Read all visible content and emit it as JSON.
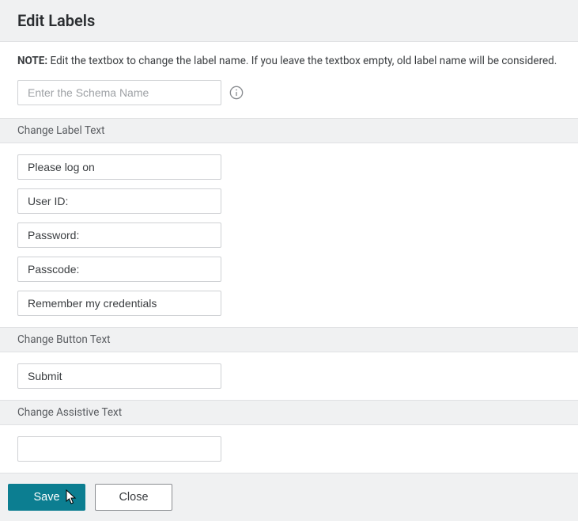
{
  "header": {
    "title": "Edit Labels"
  },
  "note": {
    "prefix": "NOTE:",
    "text": "Edit the textbox to change the label name. If you leave the textbox empty, old label name will be considered."
  },
  "schema": {
    "placeholder": "Enter the Schema Name",
    "value": ""
  },
  "sections": {
    "label_text": {
      "title": "Change Label Text",
      "fields": [
        "Please log on",
        "User ID:",
        "Password:",
        "Passcode:",
        "Remember my credentials"
      ]
    },
    "button_text": {
      "title": "Change Button Text",
      "fields": [
        "Submit"
      ]
    },
    "assistive_text": {
      "title": "Change Assistive Text",
      "fields": [
        ""
      ]
    }
  },
  "footer": {
    "save": "Save",
    "close": "Close"
  }
}
